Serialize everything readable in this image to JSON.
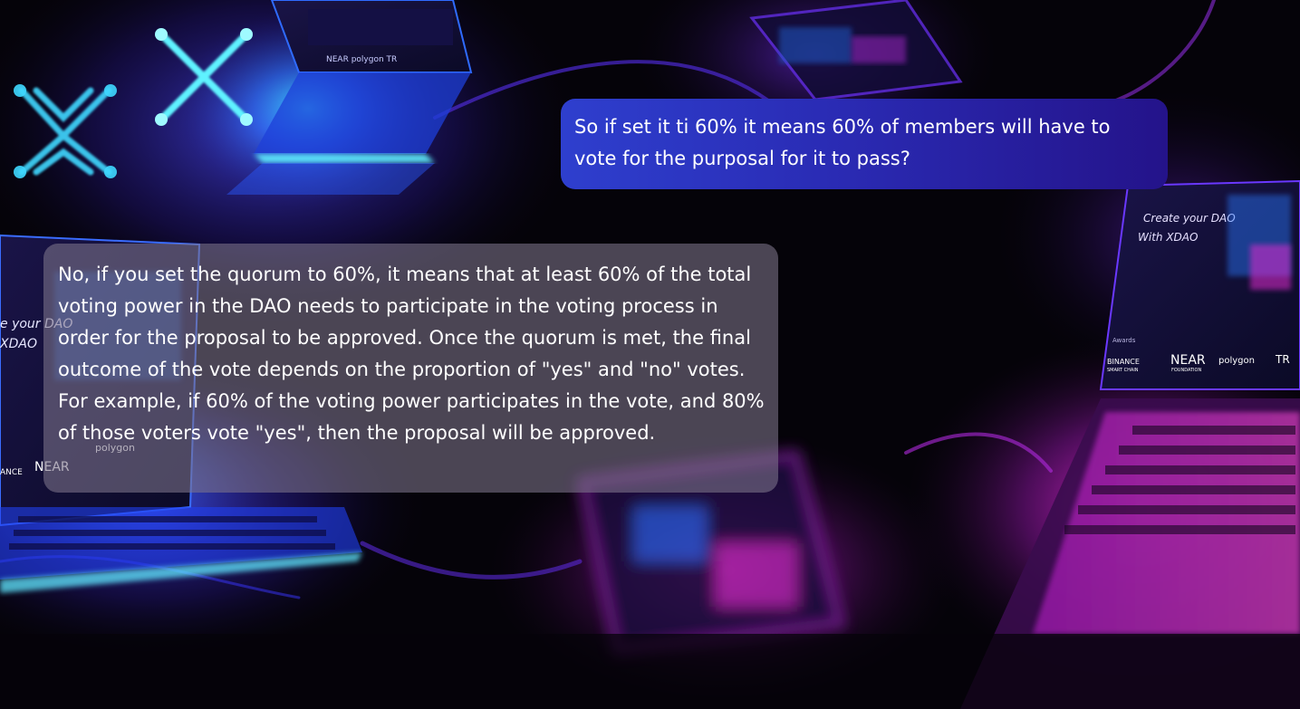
{
  "conversation": {
    "messages": [
      {
        "role": "user",
        "text": "So if set it ti 60% it means 60% of members will have to vote for the purposal for it to pass?"
      },
      {
        "role": "assistant",
        "text": "No, if you set the quorum to 60%, it means that at least 60% of the total voting power in the DAO needs to participate in the voting process in order for the proposal to be approved. Once the quorum is met, the final outcome of the vote depends on the proportion of \"yes\" and \"no\" votes. For example, if 60% of the voting power participates in the vote, and 80% of those voters vote \"yes\", then the proposal will be approved."
      }
    ]
  },
  "background": {
    "description_colors": {
      "base": "#050309",
      "cyan_glow": "#2fd8ff",
      "blue_glow": "#3b3cff",
      "magenta_glow": "#e01ccf",
      "purple_glow": "#6a1fc4"
    },
    "screen_texts": [
      "Create your DAO",
      "With XDAO",
      "Awards",
      "BINANCE",
      "SMART CHAIN",
      "NEAR",
      "FOUNDATION",
      "polygon",
      "TR",
      "e your DAO",
      "XDAO",
      "NEAR",
      "ANCE",
      "polygon"
    ]
  }
}
